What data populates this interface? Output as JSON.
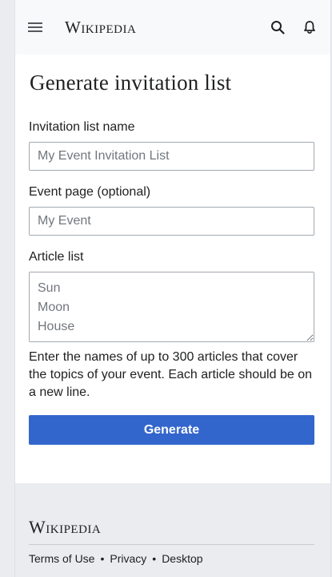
{
  "header": {
    "wordmark": "Wikipedia",
    "menu_icon": "hamburger-menu-icon",
    "search_icon": "search-icon",
    "notifications_icon": "bell-icon"
  },
  "page": {
    "title": "Generate invitation list"
  },
  "form": {
    "list_name_label": "Invitation list name",
    "list_name_placeholder": "My Event Invitation List",
    "list_name_value": "",
    "event_page_label": "Event page (optional)",
    "event_page_placeholder": "My Event",
    "event_page_value": "",
    "article_list_label": "Article list",
    "article_list_placeholder": "Sun\nMoon\nHouse",
    "article_list_value": "",
    "help_text": "Enter the names of up to 300 articles that cover the topics of your event. Each article should be on a new line.",
    "generate_label": "Generate"
  },
  "footer": {
    "wordmark": "Wikipedia",
    "links": [
      "Terms of Use",
      "Privacy",
      "Desktop"
    ],
    "separator": "•"
  },
  "colors": {
    "primary_button": "#3366cc",
    "page_background": "#eaecf0",
    "border": "#a2a9b1"
  }
}
